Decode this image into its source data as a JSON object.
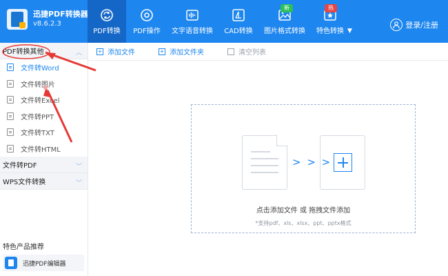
{
  "app": {
    "name": "迅捷PDF转换器",
    "version": "v8.6.2.3"
  },
  "nav": {
    "items": [
      {
        "label": "PDF转换",
        "icon": "pdf-convert-icon",
        "active": true
      },
      {
        "label": "PDF操作",
        "icon": "pdf-operate-icon"
      },
      {
        "label": "文字语音转换",
        "icon": "audio-icon"
      },
      {
        "label": "CAD转换",
        "icon": "cad-icon"
      },
      {
        "label": "图片格式转换",
        "icon": "image-icon",
        "badge": "新"
      },
      {
        "label": "特色转换",
        "icon": "star-icon",
        "badge": "热"
      }
    ],
    "login": "登录/注册"
  },
  "sidebar": {
    "sections": [
      {
        "label": "PDF转换其他",
        "expanded": true
      },
      {
        "label": "文件转PDF",
        "expanded": false
      },
      {
        "label": "WPS文件转换",
        "expanded": false
      }
    ],
    "items": [
      {
        "label": "文件转Word",
        "active": true
      },
      {
        "label": "文件转图片",
        "active": false
      },
      {
        "label": "文件转Excel",
        "active": false
      },
      {
        "label": "文件转PPT",
        "active": false
      },
      {
        "label": "文件转TXT",
        "active": false
      },
      {
        "label": "文件转HTML",
        "active": false
      }
    ],
    "recommend_title": "特色产品推荐",
    "recommend_item": "迅捷PDF编辑器"
  },
  "toolbar": {
    "add_file": "添加文件",
    "add_folder": "添加文件夹",
    "clear_list": "清空列表"
  },
  "dropzone": {
    "text": "点击添加文件 或 拖拽文件添加",
    "hint": "*支持pdf、xls、xlsx、ppt、pptx格式",
    "arrows": "> > >"
  },
  "colors": {
    "header": "#1d86ef",
    "active_nav": "#1567c7",
    "accent": "#1d86ef",
    "annotation": "#e53935"
  }
}
